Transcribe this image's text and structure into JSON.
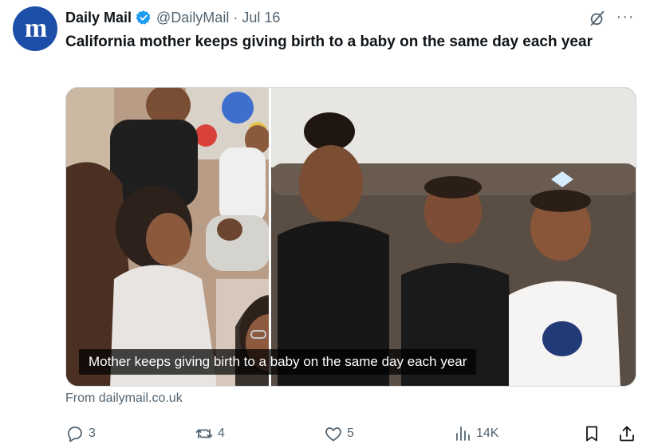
{
  "author": {
    "avatar_letter": "m",
    "display_name": "Daily Mail",
    "handle": "@DailyMail",
    "separator": "·",
    "date": "Jul 16",
    "verified": true,
    "brand_color": "#1d4fa8",
    "verified_color": "#1d9bf0"
  },
  "header_actions": {
    "grok_icon": "grok-slash-icon",
    "more_label": "···"
  },
  "tweet": {
    "text": "California mother keeps giving birth to a baby on the same day each year"
  },
  "media": {
    "caption": "Mother keeps giving birth to a baby on the same day each year"
  },
  "link": {
    "source": "From dailymail.co.uk"
  },
  "actions": {
    "reply": {
      "icon": "reply-icon",
      "count": "3"
    },
    "repost": {
      "icon": "repost-icon",
      "count": "4"
    },
    "like": {
      "icon": "like-icon",
      "count": "5"
    },
    "views": {
      "icon": "views-icon",
      "count": "14K"
    },
    "bookmark": {
      "icon": "bookmark-icon"
    },
    "share": {
      "icon": "share-icon"
    }
  },
  "colors": {
    "text_primary": "#0f1419",
    "text_secondary": "#536471"
  }
}
